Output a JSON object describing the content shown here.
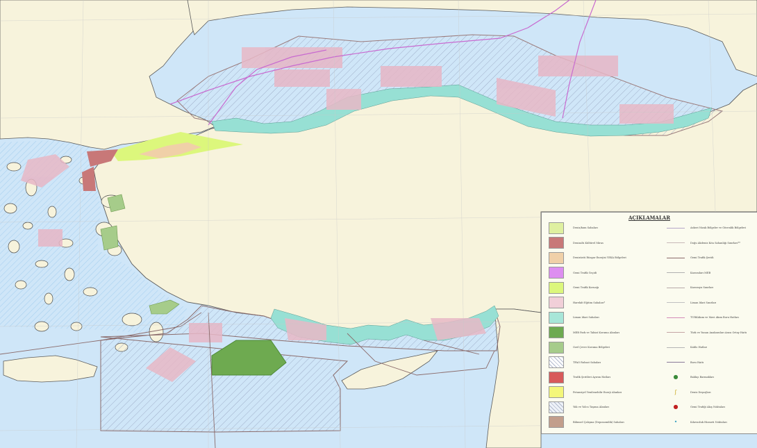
{
  "legend": {
    "title": "AÇIKLAMALAR",
    "left_items": [
      {
        "label": "Deniz/kum Sahaları",
        "fill": "#dff0a0",
        "hatch": false
      },
      {
        "label": "Denizaltı Kültürel Miras",
        "fill": "#c87878",
        "hatch": false
      },
      {
        "label": "Denizüstü Rüzgar Enerjisi YEKA Bölgeleri",
        "fill": "#f0d0a8",
        "hatch": false
      },
      {
        "label": "Gemi Trafik Geçidi",
        "fill": "#dd8ef0",
        "hatch": false
      },
      {
        "label": "Gemi Trafik Koruağı",
        "fill": "#dcf77c",
        "hatch": false
      },
      {
        "label": "Harekât Eğitim Sahaları*",
        "fill": "#f1cfd8",
        "hatch": false
      },
      {
        "label": "Liman İdari Sahaları",
        "fill": "#a8e6d8",
        "hatch": false
      },
      {
        "label": "MEB Park ve Tabiat Koruma Alanları",
        "fill": "#6eaa50",
        "hatch": false
      },
      {
        "label": "Özel Çevre Koruma Bölgeleri",
        "fill": "#a6cc8a",
        "hatch": false
      },
      {
        "label": "TPAO Ruhsat Sahaları",
        "fill": "#ffffff",
        "hatch": true
      },
      {
        "label": "Trafik Şeritleri Ayırım Hatları",
        "fill": "#d85a5a",
        "hatch": false
      },
      {
        "label": "Potansiyel Yenilenebilir Enerji Alanları",
        "fill": "#f4f77a",
        "hatch": false
      },
      {
        "label": "Yük ve Yolcu Taşıma Alanları",
        "fill": "#eef2f8",
        "hatch": true
      },
      {
        "label": "Bilimsel Çalışma (Deponomilik) Sahaları",
        "fill": "#c29e8c",
        "hatch": false
      }
    ],
    "right_items": [
      {
        "label": "Askeri Nizak Bölgeler ve Güvenlik Bölgeleri",
        "kind": "line",
        "color": "#b6a6c8"
      },
      {
        "label": "Doğu Akdeniz Kıta Sahanlığı Sınırları**",
        "kind": "line",
        "color": "#c8b8b8"
      },
      {
        "label": "Gemi Trafik Şeridi",
        "kind": "line",
        "color": "#8a6a6a"
      },
      {
        "label": "Karasuları MEB",
        "kind": "line",
        "color": "#b0b0b0"
      },
      {
        "label": "Karasuyu Sınırları",
        "kind": "line",
        "color": "#b8a8a8"
      },
      {
        "label": "Liman İdari Sınırları",
        "kind": "line",
        "color": "#c0c0c0"
      },
      {
        "label": "TÜRKAkım ve Mavi Akım Boru Hatları",
        "kind": "line",
        "color": "#d48ab8"
      },
      {
        "label": "Türk ve Yunan Anakaraları Arası Ortay Hattı",
        "kind": "line",
        "color": "#c4a4a4"
      },
      {
        "label": "Kablo Hatları",
        "kind": "line",
        "color": "#b4b4b4"
      },
      {
        "label": "Boru Hattı",
        "kind": "line",
        "color": "#8a7a9a"
      },
      {
        "label": "Balıkçı Barınakları",
        "kind": "point",
        "symbol": "●",
        "color": "#3a8a3a"
      },
      {
        "label": "Deniz Deşarjları",
        "kind": "point",
        "symbol": "ʃ",
        "color": "#c8a820"
      },
      {
        "label": "Gemi Trafiği Akış Noktaları",
        "kind": "point",
        "symbol": "●",
        "color": "#c02020"
      },
      {
        "label": "Kılavuzluk Hizmeti Noktaları",
        "kind": "point",
        "symbol": "•",
        "color": "#3aa0c0"
      }
    ]
  },
  "colors": {
    "sea": "#cfe6f8",
    "land": "#f7f3dc",
    "coast": "#5a5a5a",
    "harbor": "#97e0d4",
    "training": "#e7b7c6",
    "park": "#6eaa50",
    "pipeline": "#c86ad0"
  }
}
